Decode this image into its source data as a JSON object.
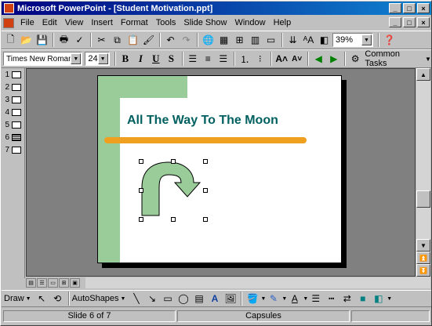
{
  "window": {
    "title": "Microsoft PowerPoint - [Student Motivation.ppt]",
    "minimize": "_",
    "maximize": "□",
    "close": "×"
  },
  "menu": [
    {
      "label": "File"
    },
    {
      "label": "Edit"
    },
    {
      "label": "View"
    },
    {
      "label": "Insert"
    },
    {
      "label": "Format"
    },
    {
      "label": "Tools"
    },
    {
      "label": "Slide Show"
    },
    {
      "label": "Window"
    },
    {
      "label": "Help"
    }
  ],
  "standard_toolbar": {
    "zoom": "39%"
  },
  "formatting_toolbar": {
    "font_name": "Times New Roman",
    "font_size": "24",
    "bold": "B",
    "italic": "I",
    "underline": "U",
    "shadow": "S",
    "common_tasks": "Common Tasks"
  },
  "outline": {
    "slides": [
      "1",
      "2",
      "3",
      "4",
      "5",
      "6",
      "7"
    ],
    "current": 6
  },
  "slide": {
    "title": "All The Way To The Moon"
  },
  "drawing_toolbar": {
    "draw": "Draw",
    "autoshapes": "AutoShapes"
  },
  "status_bar": {
    "slide_info": "Slide 6 of 7",
    "design": "Capsules"
  },
  "colors": {
    "title_bar": "#000080",
    "slide_title": "#006060",
    "accent_green": "#99cc99",
    "accent_orange": "#f0a020",
    "arrow_fill": "#99cc99"
  }
}
